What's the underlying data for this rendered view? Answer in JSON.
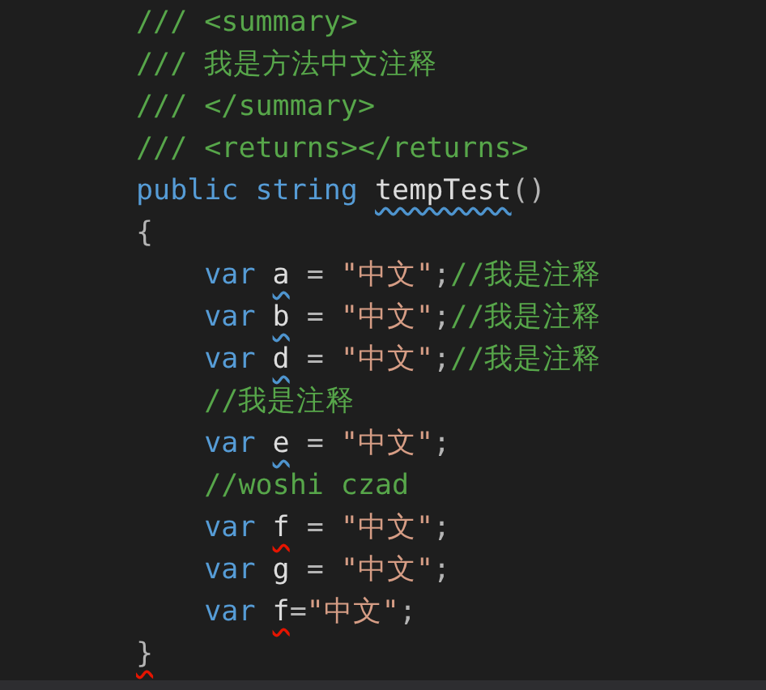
{
  "editor": {
    "lines": [
      {
        "tokens": [
          {
            "kind": "comment",
            "text": "/// <summary>"
          }
        ]
      },
      {
        "tokens": [
          {
            "kind": "comment",
            "text": "/// 我是方法中文注释"
          }
        ]
      },
      {
        "tokens": [
          {
            "kind": "comment",
            "text": "/// </summary>"
          }
        ]
      },
      {
        "tokens": [
          {
            "kind": "comment",
            "text": "/// <returns></returns>"
          }
        ]
      },
      {
        "tokens": [
          {
            "kind": "keyword",
            "text": "public string "
          },
          {
            "kind": "identifier",
            "text": "tempTest",
            "info": true,
            "error": false
          },
          {
            "kind": "punctuation",
            "text": "()"
          }
        ]
      },
      {
        "tokens": [
          {
            "kind": "punctuation",
            "text": "{"
          }
        ]
      },
      {
        "tokens": [
          {
            "kind": "keyword",
            "text": "    var "
          },
          {
            "kind": "identifier",
            "text": "a",
            "info": true,
            "error": false
          },
          {
            "kind": "punctuation",
            "text": " = "
          },
          {
            "kind": "string",
            "text": "\"中文\""
          },
          {
            "kind": "punctuation",
            "text": ";"
          },
          {
            "kind": "comment",
            "text": "//我是注释"
          }
        ]
      },
      {
        "tokens": [
          {
            "kind": "keyword",
            "text": "    var "
          },
          {
            "kind": "identifier",
            "text": "b",
            "info": true,
            "error": false
          },
          {
            "kind": "punctuation",
            "text": " = "
          },
          {
            "kind": "string",
            "text": "\"中文\""
          },
          {
            "kind": "punctuation",
            "text": ";"
          },
          {
            "kind": "comment",
            "text": "//我是注释"
          }
        ]
      },
      {
        "tokens": [
          {
            "kind": "keyword",
            "text": "    var "
          },
          {
            "kind": "identifier",
            "text": "d",
            "info": true,
            "error": false
          },
          {
            "kind": "punctuation",
            "text": " = "
          },
          {
            "kind": "string",
            "text": "\"中文\""
          },
          {
            "kind": "punctuation",
            "text": ";"
          },
          {
            "kind": "comment",
            "text": "//我是注释"
          }
        ]
      },
      {
        "tokens": [
          {
            "kind": "comment",
            "text": "    //我是注释"
          }
        ]
      },
      {
        "tokens": [
          {
            "kind": "keyword",
            "text": "    var "
          },
          {
            "kind": "identifier",
            "text": "e",
            "info": true,
            "error": false
          },
          {
            "kind": "punctuation",
            "text": " = "
          },
          {
            "kind": "string",
            "text": "\"中文\""
          },
          {
            "kind": "punctuation",
            "text": ";"
          }
        ]
      },
      {
        "tokens": [
          {
            "kind": "comment",
            "text": "    //woshi czad"
          }
        ]
      },
      {
        "tokens": [
          {
            "kind": "keyword",
            "text": "    var "
          },
          {
            "kind": "identifier",
            "text": "f",
            "info": false,
            "error": true
          },
          {
            "kind": "punctuation",
            "text": " = "
          },
          {
            "kind": "string",
            "text": "\"中文\""
          },
          {
            "kind": "punctuation",
            "text": ";"
          }
        ]
      },
      {
        "tokens": [
          {
            "kind": "keyword",
            "text": "    var "
          },
          {
            "kind": "identifier",
            "text": "g",
            "info": false,
            "error": false
          },
          {
            "kind": "punctuation",
            "text": " = "
          },
          {
            "kind": "string",
            "text": "\"中文\""
          },
          {
            "kind": "punctuation",
            "text": ";"
          }
        ]
      },
      {
        "tokens": [
          {
            "kind": "keyword",
            "text": "    var "
          },
          {
            "kind": "identifier",
            "text": "f",
            "info": false,
            "error": true
          },
          {
            "kind": "punctuation",
            "text": "="
          },
          {
            "kind": "string",
            "text": "\"中文\""
          },
          {
            "kind": "punctuation",
            "text": ";"
          }
        ]
      },
      {
        "tokens": [
          {
            "kind": "punctuation",
            "text": "}",
            "info": false,
            "error": true
          }
        ]
      }
    ]
  }
}
